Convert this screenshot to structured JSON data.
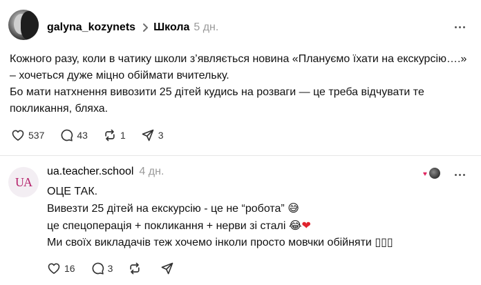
{
  "post1": {
    "username": "galyna_kozynets",
    "community": "Школа",
    "time": "5 дн.",
    "text_lines": [
      "Кожного разу, коли в чатику школи з’являється новина «Плануємо їхати на екскурсію….» – хочеться дуже міцно обіймати вчительку.",
      "Бо мати натхнення вивозити 25 дітей кудись на розваги — це треба відчувати те покликання, бляха."
    ],
    "likes": "537",
    "comments": "43",
    "reposts": "1",
    "shares": "3"
  },
  "post2": {
    "username": "ua.teacher.school",
    "time": "4 дн.",
    "avatar_text": "UA",
    "line1": "ОЦЕ ТАК.",
    "line2": "Вивезти 25 дітей на екскурсію - це не “робота”",
    "line2_emoji": "😅",
    "line3": "це спецоперація + покликання + нерви зі сталі",
    "line3_emoji": "😂",
    "line3_heart": "❤",
    "line4": "Ми своїх викладачів теж хочемо інколи просто мовчки обійняти",
    "line4_tail": "▯▯▯",
    "likes": "16",
    "comments": "3"
  },
  "icons": {
    "like": "heart-icon",
    "comment": "comment-icon",
    "repost": "repost-icon",
    "share": "share-icon",
    "more": "more-icon",
    "chevron": "chevron-right-icon"
  },
  "colors": {
    "muted": "#9a9a9a",
    "divider": "#e6e6e6",
    "heart": "#e0242e",
    "brand": "#b5226b"
  }
}
